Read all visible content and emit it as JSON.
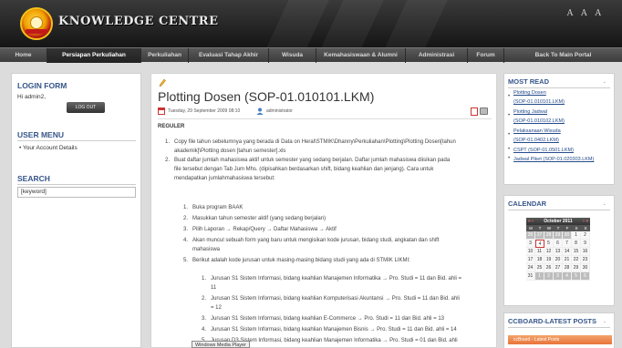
{
  "header": {
    "site_title": "KNOWLEDGE CENTRE",
    "font_size_controls": "A A A"
  },
  "nav": {
    "items": [
      "Home",
      "Persiapan Perkuliahan",
      "Perkuliahan",
      "Evaluasi Tahap Akhir",
      "Wisuda",
      "Kemahasiswaan & Alumni",
      "Administrasi",
      "Forum",
      "Back To Main Portal"
    ],
    "active_index": 1
  },
  "left": {
    "login_heading": "LOGIN FORM",
    "login_user": "Hi admin2,",
    "logout_label": "LOG OUT",
    "user_menu_heading": "USER MENU",
    "account_link": "• Your Account Details",
    "search_heading": "SEARCH",
    "search_value": "[keyword]"
  },
  "article": {
    "title": "Plotting Dosen (SOP-01.010101.LKM)",
    "date": "Tuesday, 29 September 2009 08:10",
    "author": "administrator",
    "section": "REGULER",
    "steps": [
      {
        "n": "1.",
        "lines": [
          "Copy file tahun sebelumnya yang berada di Data on Heral\\STMIK\\Dhanny\\Perkuliahan\\Plotting\\Plotting Dosen[tahun",
          "akademik]\\Plotting dosen [tahun semester].xls"
        ]
      },
      {
        "n": "2.",
        "lines": [
          "Buat daftar jumlah mahasiswa aktif untuk semester yang sedang berjalan. Daftar jumlah mahasiswa diisikan pada",
          "file tersebut dengan Tab Jum Mhs. (dipisahkan berdasarkan shift, bidang keahlian dan jenjang). Cara untuk",
          "mendapatkan jumlahmahasiswa tersebut:"
        ]
      }
    ],
    "substeps": [
      {
        "n": "1.",
        "lines": [
          "Buka program BAAK"
        ]
      },
      {
        "n": "2.",
        "lines": [
          "Masukkan tahun semester aktif (yang sedang berjalan)"
        ]
      },
      {
        "n": "3.",
        "lines": [
          "Pilih Laporan → Rekap/Query → Daftar Mahasiswa → Aktif"
        ]
      },
      {
        "n": "4.",
        "lines": [
          "Akan muncul sebuah form yang baru untuk mengisikan kode jurusan, bidang studi, angkatan dan shift",
          "mahasiswa"
        ]
      },
      {
        "n": "5.",
        "lines": [
          "Berikut adalah kode jurusan untuk masing-masing bidang studi yang ada di STMIK LIKMI:"
        ]
      }
    ],
    "codes": [
      {
        "n": "1.",
        "lines": [
          "Jurusan S1 Sistem Informasi, bidang keahlian Manajemen Informatika → Pro. Studi = 11 dan Bid. ahli =",
          "11"
        ]
      },
      {
        "n": "2.",
        "lines": [
          "Jurusan S1 Sistem Informasi, bidang keahlian Komputerisasi Akuntansi → Pro. Studi = 11 dan Bid. ahli",
          "= 12"
        ]
      },
      {
        "n": "3.",
        "lines": [
          "Jurusan S1 Sistem Informasi, bidang keahlian E-Commerce → Pro. Studi = 11 dan Bid. ahli = 13"
        ]
      },
      {
        "n": "4.",
        "lines": [
          "Jurusan S1 Sistem Informasi, bidang keahlian Manajemen Bisnis → Pro. Studi = 11 dan Bid. ahli = 14"
        ]
      },
      {
        "n": "5.",
        "lines": [
          "Jurusan D3 Sistem Informasi, bidang keahlian Manajemen Informatika → Pro. Studi = 01 dan Bid. ahli"
        ]
      }
    ],
    "media_tag": "Windows Media Player"
  },
  "most_read": {
    "heading": "MOST READ",
    "items": [
      [
        "Plotting Dosen",
        "(SOP-01.010101.LKM)"
      ],
      [
        "Plotting Jadwal",
        "(SOP-01.010102.LKM)"
      ],
      [
        "Pelaksanaan Wisuda",
        "(SOP-01.0402.LKM)"
      ],
      [
        "CSPT (SOP-01.0501.LKM)"
      ],
      [
        "Jadwal Piket (SOP-01.020303.LKM)"
      ]
    ]
  },
  "calendar": {
    "heading": "CALENDAR",
    "prev": "« ‹",
    "next": "› »",
    "month": "October 2011",
    "dow": [
      "M",
      "T",
      "W",
      "T",
      "F",
      "S",
      "S"
    ],
    "days": [
      "26",
      "27",
      "28",
      "29",
      "30",
      "1",
      "2",
      "3",
      "4",
      "5",
      "6",
      "7",
      "8",
      "9",
      "10",
      "11",
      "12",
      "13",
      "14",
      "15",
      "16",
      "17",
      "18",
      "19",
      "20",
      "21",
      "22",
      "23",
      "24",
      "25",
      "26",
      "27",
      "28",
      "29",
      "30",
      "31",
      "1",
      "2",
      "3",
      "4",
      "5",
      "6"
    ],
    "today": "4"
  },
  "ccboard": {
    "heading": "CCBOARD-LATEST POSTS",
    "bar_label": "ccBoard - Latest Posts"
  },
  "colors": {
    "heading_blue": "#36568a",
    "link_blue": "#244a8a",
    "nav_bg": "#4a4a4a"
  }
}
